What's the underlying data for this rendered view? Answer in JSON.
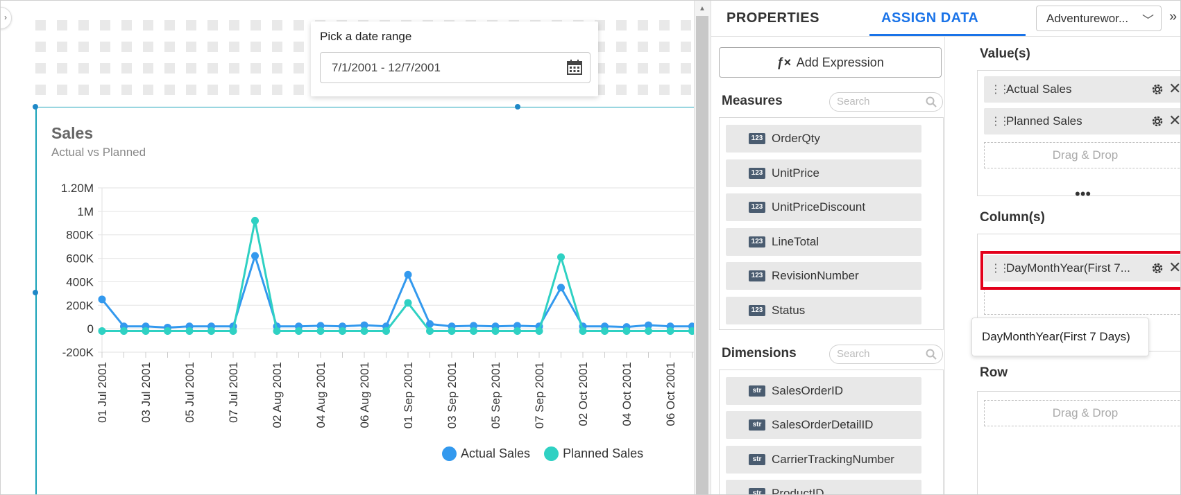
{
  "date_picker": {
    "label": "Pick a date range",
    "value": "7/1/2001 - 12/7/2001"
  },
  "chart_data": {
    "type": "line",
    "title": "Sales",
    "subtitle": "Actual vs Planned",
    "categories": [
      "01 Jul 2001",
      "",
      "03 Jul 2001",
      "",
      "05 Jul 2001",
      "",
      "07 Jul 2001",
      "",
      "02 Aug 2001",
      "",
      "04 Aug 2001",
      "",
      "06 Aug 2001",
      "",
      "01 Sep 2001",
      "",
      "03 Sep 2001",
      "",
      "05 Sep 2001",
      "",
      "07 Sep 2001",
      "",
      "02 Oct 2001",
      "",
      "04 Oct 2001",
      "",
      "06 Oct 2001",
      ""
    ],
    "tick_labels": [
      "01 Jul 2001",
      "03 Jul 2001",
      "05 Jul 2001",
      "07 Jul 2001",
      "02 Aug 2001",
      "04 Aug 2001",
      "06 Aug 2001",
      "01 Sep 2001",
      "03 Sep 2001",
      "05 Sep 2001",
      "07 Sep 2001",
      "02 Oct 2001",
      "04 Oct 2001",
      "06 Oct 2001"
    ],
    "y_ticks": [
      "1.20M",
      "1M",
      "800K",
      "600K",
      "400K",
      "200K",
      "0",
      "-200K"
    ],
    "ylim": [
      -200000,
      1200000
    ],
    "series": [
      {
        "name": "Actual Sales",
        "color": "#3399ee",
        "values": [
          250000,
          20000,
          20000,
          10000,
          20000,
          20000,
          20000,
          620000,
          20000,
          20000,
          25000,
          20000,
          30000,
          20000,
          460000,
          40000,
          20000,
          25000,
          20000,
          25000,
          20000,
          350000,
          20000,
          20000,
          15000,
          30000,
          20000,
          20000
        ]
      },
      {
        "name": "Planned Sales",
        "color": "#2fd1c3",
        "values": [
          -20000,
          -20000,
          -20000,
          -20000,
          -20000,
          -20000,
          -20000,
          920000,
          -20000,
          -20000,
          -20000,
          -20000,
          -20000,
          -20000,
          220000,
          -20000,
          -20000,
          -20000,
          -20000,
          -20000,
          -20000,
          610000,
          -20000,
          -20000,
          -20000,
          -20000,
          -20000,
          -20000
        ]
      }
    ],
    "legend": [
      "Actual Sales",
      "Planned Sales"
    ],
    "legend_position": "bottom-right",
    "grid": true
  },
  "panel": {
    "tabs": [
      "PROPERTIES",
      "ASSIGN DATA"
    ],
    "active_tab": "ASSIGN DATA",
    "data_source": "Adventurewor...",
    "add_expression": "Add Expression",
    "measures_title": "Measures",
    "dimensions_title": "Dimensions",
    "search_placeholder": "Search",
    "measures": [
      {
        "badge": "123",
        "name": "OrderQty"
      },
      {
        "badge": "123",
        "name": "UnitPrice"
      },
      {
        "badge": "123",
        "name": "UnitPriceDiscount"
      },
      {
        "badge": "123",
        "name": "LineTotal"
      },
      {
        "badge": "123",
        "name": "RevisionNumber"
      },
      {
        "badge": "123",
        "name": "Status"
      }
    ],
    "dimensions": [
      {
        "badge": "str",
        "name": "SalesOrderID"
      },
      {
        "badge": "str",
        "name": "SalesOrderDetailID"
      },
      {
        "badge": "str",
        "name": "CarrierTrackingNumber"
      },
      {
        "badge": "str",
        "name": "ProductID"
      }
    ],
    "values_title": "Value(s)",
    "values": [
      "Actual Sales",
      "Planned Sales"
    ],
    "columns_title": "Column(s)",
    "columns": [
      "DayMonthYear(First 7..."
    ],
    "tooltip": "DayMonthYear(First 7 Days)",
    "row_title": "Row",
    "drop_label": "Drag & Drop"
  },
  "colors": {
    "accent": "#1a73e8",
    "highlight": "#e3001b",
    "selection": "#17a2b8"
  }
}
